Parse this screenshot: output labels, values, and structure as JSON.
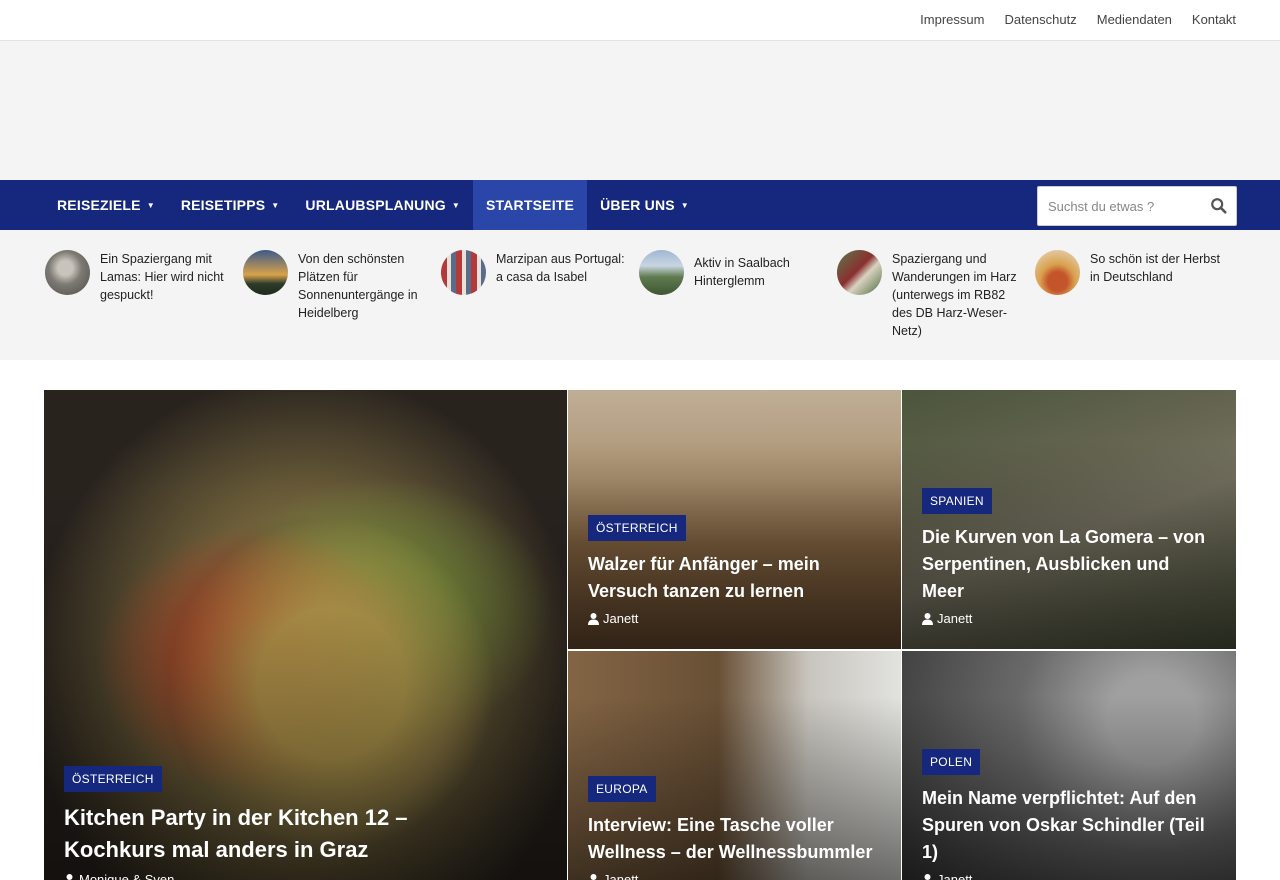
{
  "toplinks": [
    "Impressum",
    "Datenschutz",
    "Mediendaten",
    "Kontakt"
  ],
  "nav": {
    "items": [
      {
        "label": "REISEZIELE",
        "caret": true
      },
      {
        "label": "REISETIPPS",
        "caret": true
      },
      {
        "label": "URLAUBSPLANUNG",
        "caret": true
      },
      {
        "label": "STARTSEITE",
        "caret": false,
        "active": true
      },
      {
        "label": "ÜBER UNS",
        "caret": true
      }
    ],
    "search_placeholder": "Suchst du etwas ?",
    "caret_glyph": "▼"
  },
  "ticker": [
    {
      "title": "Ein Spaziergang mit Lamas: Hier wird nicht gespuckt!"
    },
    {
      "title": "Von den schönsten Plätzen für Sonnenuntergänge in Heidelberg"
    },
    {
      "title": "Marzipan aus Portugal: a casa da Isabel"
    },
    {
      "title": "Aktiv in Saalbach Hinterglemm"
    },
    {
      "title": "Spaziergang und Wanderungen im Harz (unterwegs im RB82 des DB Harz-Weser-Netz)"
    },
    {
      "title": "So schön ist der Herbst in Deutschland"
    }
  ],
  "featured": {
    "big": {
      "category": "ÖSTERREICH",
      "title": "Kitchen Party in der Kitchen 12 – Kochkurs mal anders in Graz",
      "author": "Monique & Sven"
    },
    "cards": [
      {
        "category": "ÖSTERREICH",
        "title": "Walzer für Anfänger – mein Versuch tanzen zu lernen",
        "author": "Janett"
      },
      {
        "category": "SPANIEN",
        "title": "Die Kurven von La Gomera – von Serpentinen, Ausblicken und Meer",
        "author": "Janett"
      },
      {
        "category": "EUROPA",
        "title": "Interview: Eine Tasche voller Wellness – der Wellnessbummler",
        "author": "Janett"
      },
      {
        "category": "POLEN",
        "title": "Mein Name verpflichtet: Auf den Spuren von Oskar Schindler (Teil 1)",
        "author": "Janett"
      }
    ]
  },
  "colors": {
    "nav": "#16287e",
    "nav_active": "#2a46a8",
    "badge": "#16287e"
  }
}
